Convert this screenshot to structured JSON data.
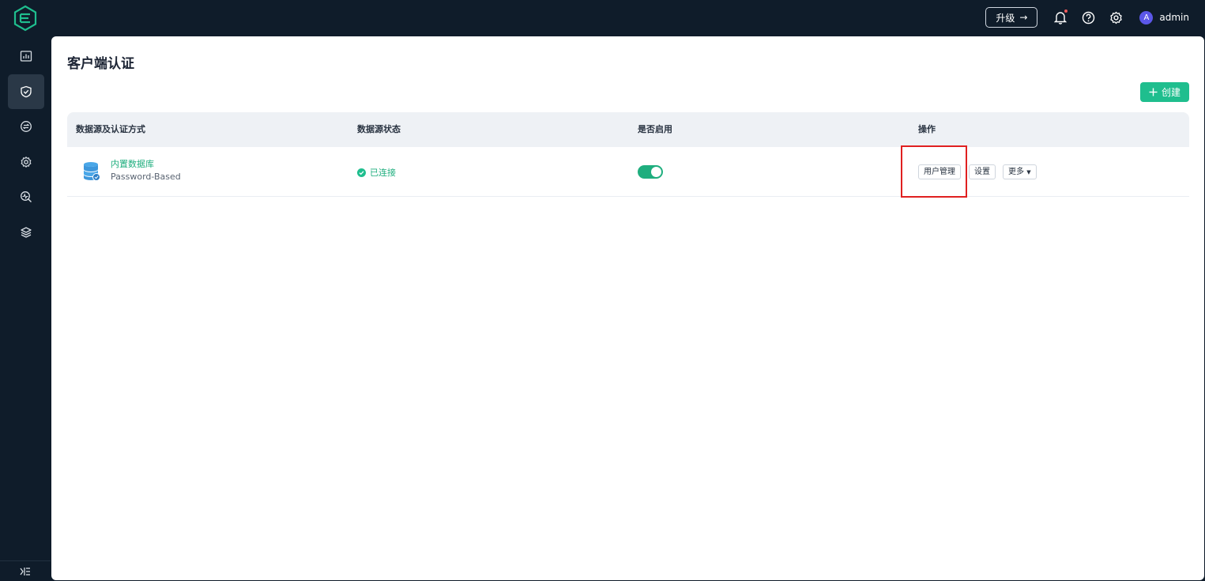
{
  "topbar": {
    "logo_icon": "emqx-logo",
    "upgrade_label": "升级",
    "upgrade_arrow": "→",
    "icons": [
      "bell-icon",
      "help-icon",
      "gear-icon"
    ],
    "user": {
      "avatar_letter": "A",
      "name": "admin"
    }
  },
  "sidebar": {
    "items": [
      {
        "name": "dashboard",
        "icon": "dashboard-icon",
        "active": false
      },
      {
        "name": "access-control",
        "icon": "shield-icon",
        "active": true
      },
      {
        "name": "integration",
        "icon": "integration-icon",
        "active": false
      },
      {
        "name": "management",
        "icon": "management-icon",
        "active": false
      },
      {
        "name": "diagnose",
        "icon": "diagnose-icon",
        "active": false
      },
      {
        "name": "system",
        "icon": "layers-icon",
        "active": false
      }
    ],
    "collapse_icon": "collapse-icon"
  },
  "page": {
    "title": "客户端认证",
    "create_label": "创建"
  },
  "table": {
    "columns": [
      "数据源及认证方式",
      "数据源状态",
      "是否启用",
      "操作"
    ],
    "rows": [
      {
        "source_name": "内置数据库",
        "auth_type": "Password-Based",
        "status": "已连接",
        "enabled": true,
        "actions": {
          "user_mgmt": "用户管理",
          "settings": "设置",
          "more": "更多"
        }
      }
    ]
  },
  "colors": {
    "accent": "#1fbe8e",
    "sidebar_bg": "#0f1c2a",
    "highlight": "#e02020"
  }
}
